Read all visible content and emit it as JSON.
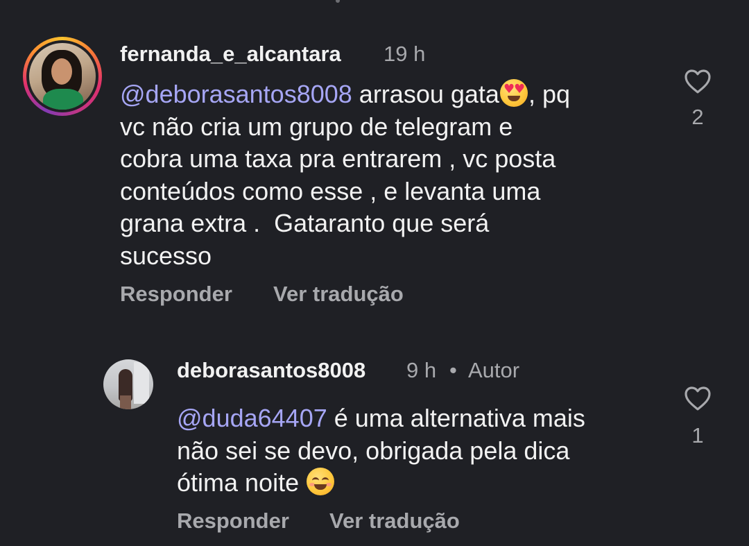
{
  "comments": [
    {
      "username": "fernanda_e_alcantara",
      "time": "19 h",
      "mention": "@deborasantos8008",
      "text_before_emoji": " arrasou gata",
      "emoji": "heart-eyes-emoji",
      "text_after_emoji": ", pq\nvc não cria um grupo de telegram e\ncobra uma taxa pra entrarem , vc posta\nconteúdos como esse , e levanta uma\ngrana extra .  Gataranto que será\nsucesso",
      "reply_label": "Responder",
      "translate_label": "Ver tradução",
      "like_count": "2"
    },
    {
      "username": "deborasantos8008",
      "time": "9 h",
      "separator": "•",
      "author_badge": "Autor",
      "mention": "@duda64407",
      "text_before_emoji": " é uma alternativa mais\nnão sei se devo, obrigada pela dica\nótima noite ",
      "emoji": "smiling-emoji",
      "reply_label": "Responder",
      "translate_label": "Ver tradução",
      "like_count": "1"
    }
  ],
  "colors": {
    "background": "#1f2025",
    "mention": "#a6a6f5",
    "secondary_text": "#a8a9ad",
    "primary_text": "#f2f2f2"
  }
}
